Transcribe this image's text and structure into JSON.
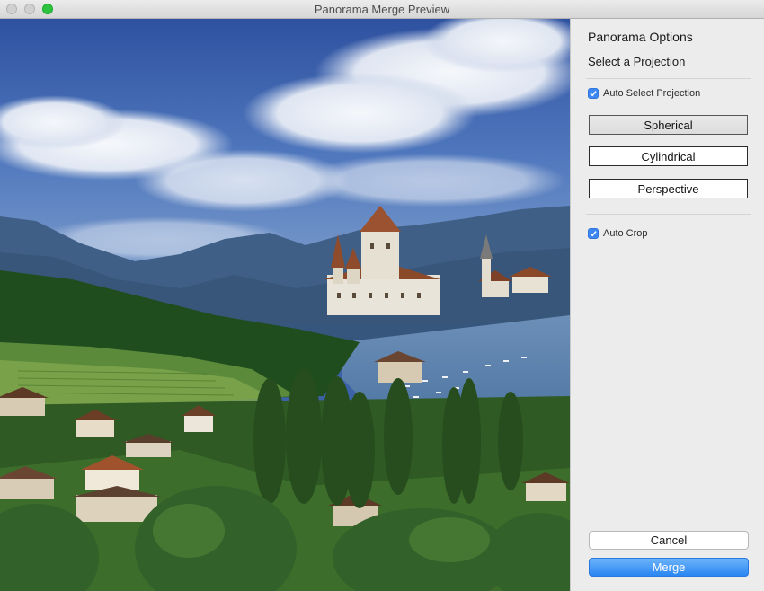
{
  "window": {
    "title": "Panorama Merge Preview"
  },
  "panel": {
    "title": "Panorama Options",
    "subtitle": "Select a Projection",
    "auto_select_projection": {
      "label": "Auto Select Projection",
      "checked": true
    },
    "projections": [
      {
        "label": "Spherical",
        "selected": true
      },
      {
        "label": "Cylindrical",
        "selected": false
      },
      {
        "label": "Perspective",
        "selected": false
      }
    ],
    "auto_crop": {
      "label": "Auto Crop",
      "checked": true
    },
    "cancel_label": "Cancel",
    "merge_label": "Merge"
  },
  "colors": {
    "accent": "#2a86f3",
    "checkbox": "#3d87f5",
    "zoom_button": "#2dc33f"
  },
  "icons": [
    "close-button",
    "minimize-button",
    "zoom-button",
    "checkmark-icon"
  ]
}
